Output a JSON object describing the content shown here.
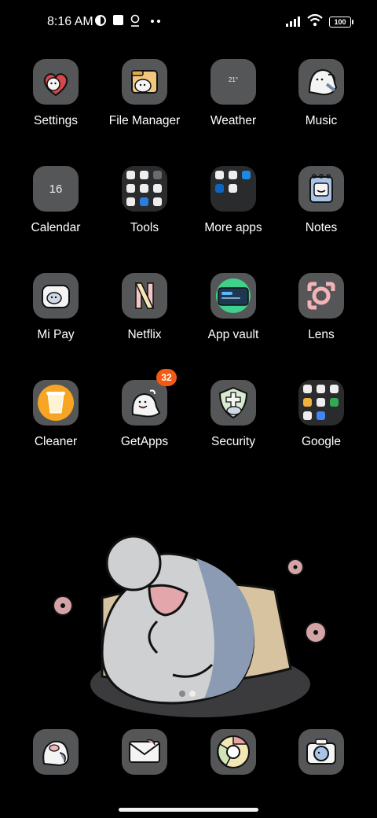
{
  "status_bar": {
    "time": "8:16 AM",
    "battery": "100"
  },
  "apps": [
    {
      "id": "settings",
      "label": "Settings"
    },
    {
      "id": "file-manager",
      "label": "File Manager"
    },
    {
      "id": "weather",
      "label": "Weather",
      "tile_text": "21°"
    },
    {
      "id": "music",
      "label": "Music"
    },
    {
      "id": "calendar",
      "label": "Calendar",
      "tile_text": "16"
    },
    {
      "id": "tools",
      "label": "Tools"
    },
    {
      "id": "more-apps",
      "label": "More apps"
    },
    {
      "id": "notes",
      "label": "Notes"
    },
    {
      "id": "mi-pay",
      "label": "Mi Pay"
    },
    {
      "id": "netflix",
      "label": "Netflix"
    },
    {
      "id": "app-vault",
      "label": "App vault"
    },
    {
      "id": "lens",
      "label": "Lens"
    },
    {
      "id": "cleaner",
      "label": "Cleaner"
    },
    {
      "id": "getapps",
      "label": "GetApps",
      "badge": "32"
    },
    {
      "id": "security",
      "label": "Security"
    },
    {
      "id": "google",
      "label": "Google"
    }
  ],
  "dock": [
    {
      "id": "dock-shark-a",
      "icon": "shark-sticker-icon"
    },
    {
      "id": "dock-messages",
      "icon": "envelope-sticker-icon"
    },
    {
      "id": "dock-chrome",
      "icon": "chrome-icon"
    },
    {
      "id": "dock-camera",
      "icon": "camera-sticker-icon"
    }
  ],
  "colors": {
    "tile": "#555657",
    "badge": "#f25a14",
    "background": "#000000"
  }
}
